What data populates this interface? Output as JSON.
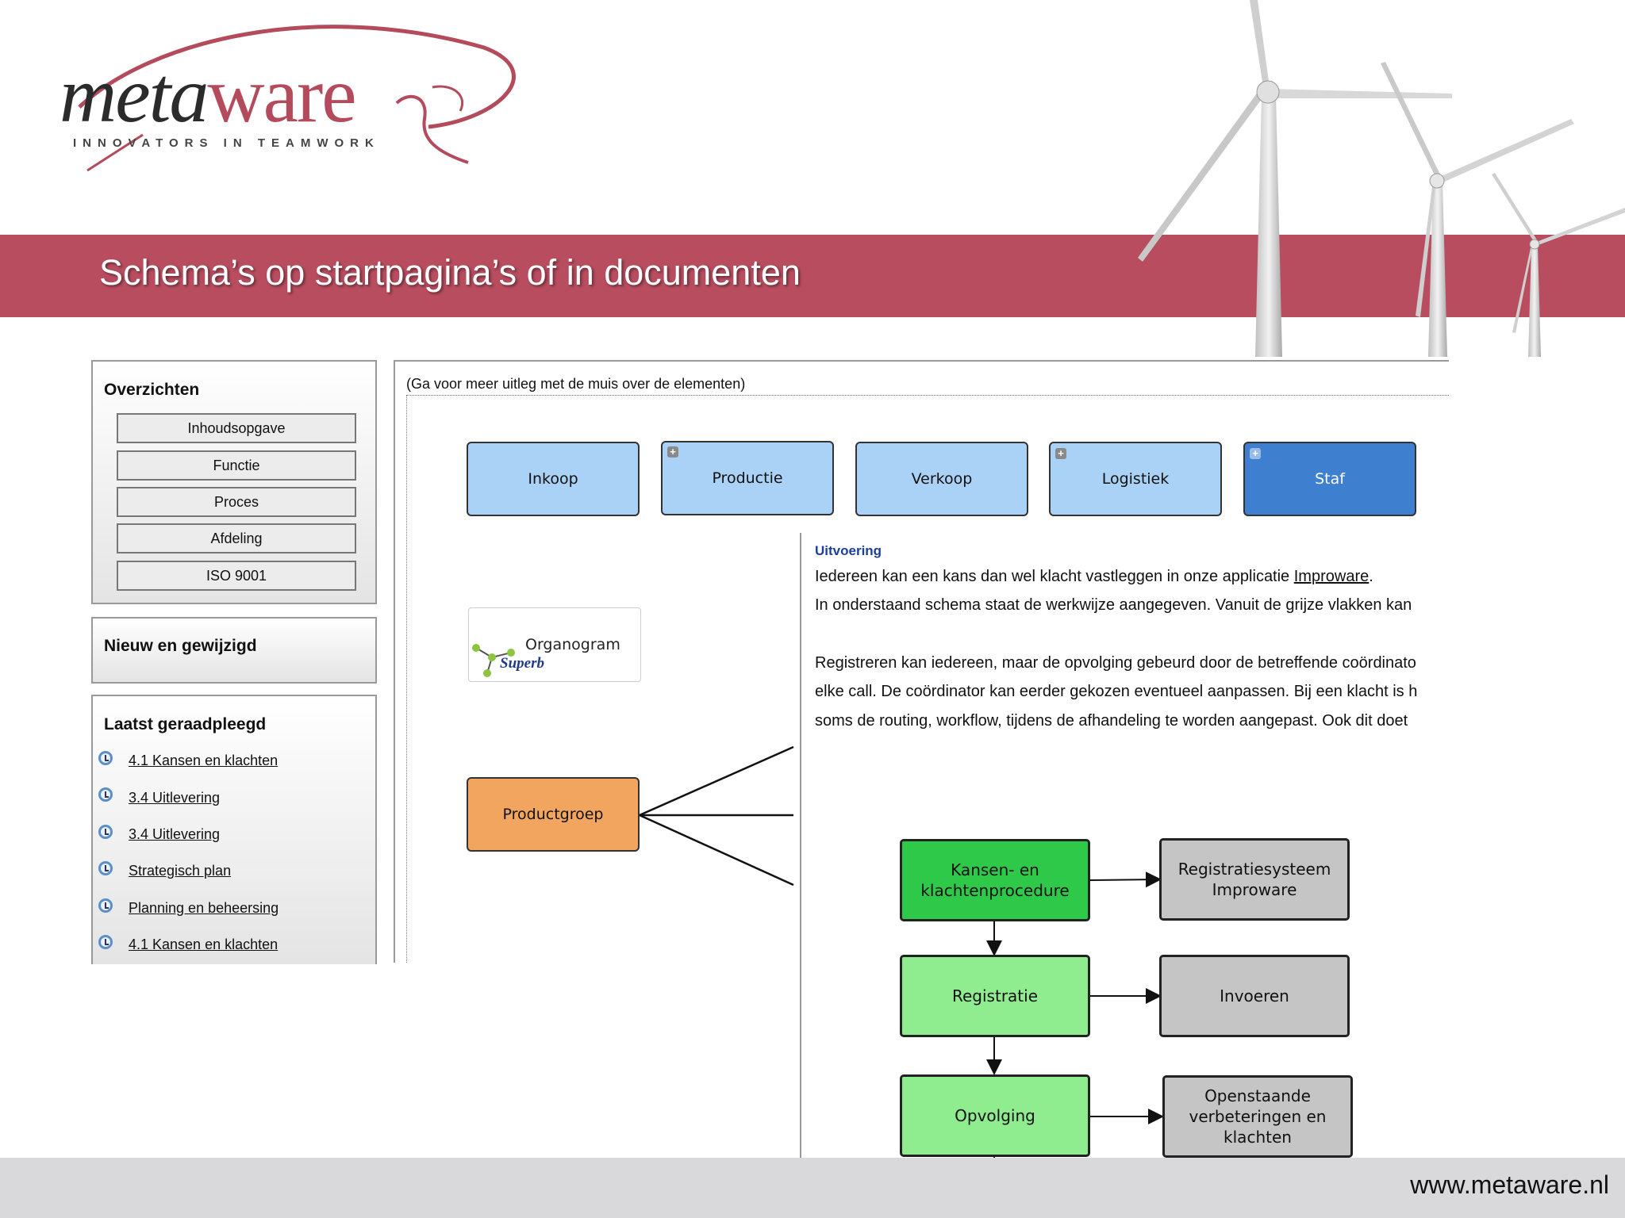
{
  "logo": {
    "word_meta": "meta",
    "word_ware": "ware",
    "tagline": "INNOVATORS IN TEAMWORK"
  },
  "banner": {
    "title": "Schema’s op startpagina’s of in documenten"
  },
  "footer": {
    "url": "www.metaware.nl"
  },
  "sidebar": {
    "overzichten": {
      "title": "Overzichten",
      "items": [
        "Inhoudsopgave",
        "Functie",
        "Proces",
        "Afdeling",
        "ISO 9001"
      ]
    },
    "nieuw": {
      "title": "Nieuw en gewijzigd"
    },
    "recent": {
      "title": "Laatst geraadpleegd",
      "links": [
        "4.1 Kansen en klachten",
        "3.4 Uitlevering",
        "3.4 Uitlevering",
        "Strategisch plan",
        "Planning en beheersing",
        "4.1 Kansen en klachten"
      ]
    }
  },
  "main": {
    "hint": "(Ga voor meer uitleg met de muis over de elementen)",
    "departments": [
      "Inkoop",
      "Productie",
      "Verkoop",
      "Logistiek",
      "Staf"
    ],
    "organogram": {
      "label": "Organogram",
      "brand": "Superb"
    },
    "productgroep": "Productgroep",
    "colors": {
      "dept_light": "#a9d2f6",
      "dept_dark": "#3f7fd0",
      "productgroep": "#f2a55f"
    }
  },
  "uitvoering": {
    "heading": "Uitvoering",
    "line1_prefix": "Iedereen kan een kans dan wel klacht vastleggen in onze applicatie ",
    "line1_link": "Improware",
    "line1_suffix": ".",
    "line2": "In onderstaand schema staat de werkwijze aangegeven. Vanuit de grijze vlakken kan",
    "line3": "Registreren kan iedereen, maar de opvolging gebeurd door de betreffende coördinato",
    "line4": "elke call. De coördinator kan eerder gekozen eventueel aanpassen. Bij een klacht is h",
    "line5": "soms de routing, workflow, tijdens de afhandeling te worden aangepast. Ook dit doet"
  },
  "flowchart": {
    "procedure": "Kansen- en klachtenprocedure",
    "registratiesysteem": "Registratiesysteem Improware",
    "registratie": "Registratie",
    "invoeren": "Invoeren",
    "opvolging": "Opvolging",
    "openstaande": "Openstaande verbeteringen en klachten",
    "colors": {
      "dark_green": "#2fc94a",
      "light_green": "#8fec8f",
      "gray": "#c5c5c5"
    }
  }
}
